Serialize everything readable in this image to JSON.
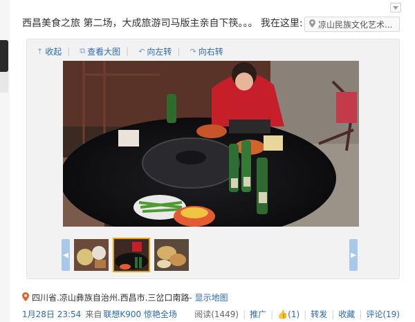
{
  "post": {
    "text": "西昌美食之旅 第二场，大成旅游司马版主亲自下筷。。。 我在这里:",
    "place_chip": "凉山民族文化艺术..."
  },
  "toolbar": {
    "collapse": "收起",
    "view_large": "查看大图",
    "rotate_left": "向左转",
    "rotate_right": "向右转"
  },
  "footer": {
    "location": "四川省.凉山彝族自治州.西昌市.三岔口南路",
    "show_map": "- 显示地图",
    "time": "1月28日 23:54",
    "from_label": "来自",
    "source": "联想K900 惊艳全场",
    "read_label": "阅读",
    "read_count": "(1449)",
    "promote": "推广",
    "like_count": "(1)",
    "forward": "转发",
    "favorite": "收藏",
    "comment": "评论",
    "comment_count": "(19)"
  },
  "colors": {
    "link": "#2a6ab8",
    "thumb_active": "#e8a316",
    "arrow": "#a9c9ea"
  },
  "icons": [
    "chevron-down-icon",
    "location-pin-icon",
    "collapse-arrow-icon",
    "zoom-icon",
    "rotate-left-icon",
    "rotate-right-icon",
    "thumbs-up-icon"
  ]
}
